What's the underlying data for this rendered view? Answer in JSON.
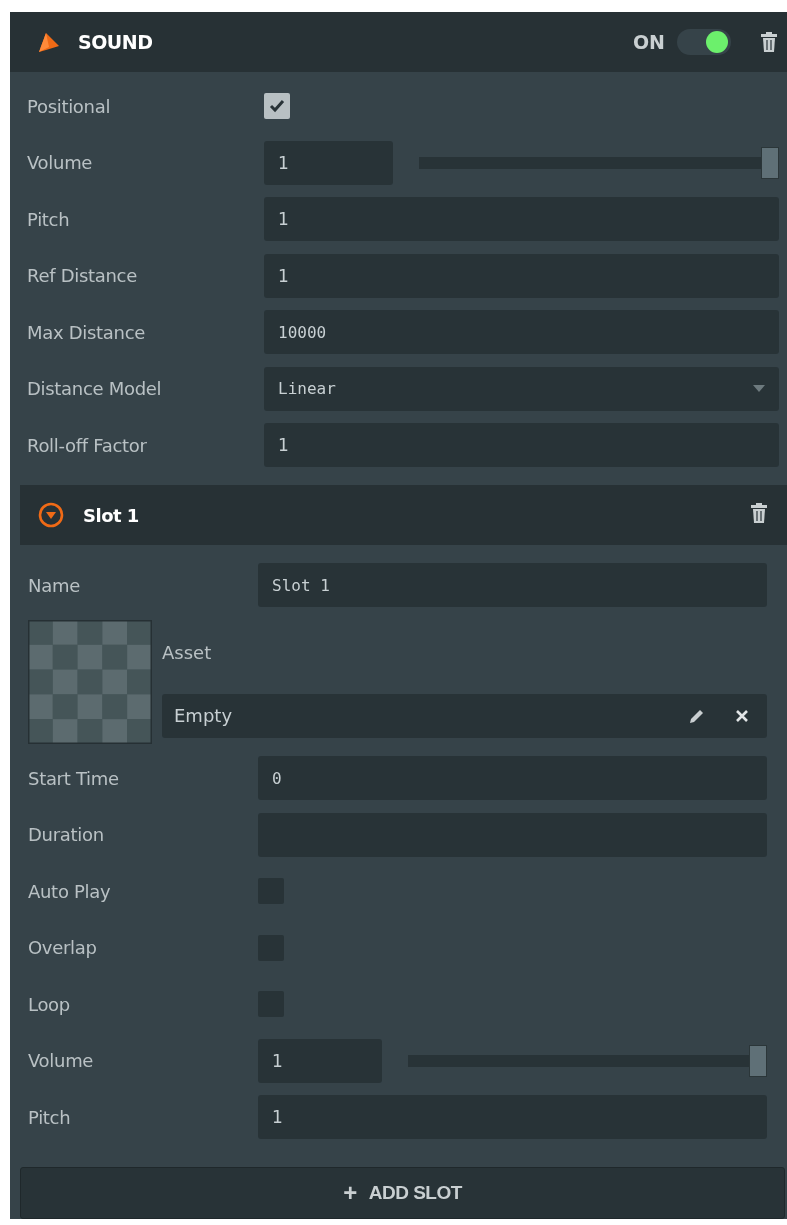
{
  "component": {
    "title": "SOUND",
    "enabled_label": "ON",
    "enabled": true
  },
  "properties": [
    {
      "kind": "checkbox",
      "label": "Positional",
      "checked": true
    },
    {
      "kind": "slider",
      "label": "Volume",
      "value": "1",
      "level": 1
    },
    {
      "kind": "field",
      "label": "Pitch",
      "value": "1"
    },
    {
      "kind": "field",
      "label": "Ref Distance",
      "value": "1"
    },
    {
      "kind": "field",
      "label": "Max Distance",
      "value": "10000",
      "mono": true
    },
    {
      "kind": "select",
      "label": "Distance Model",
      "value": "Linear"
    },
    {
      "kind": "field",
      "label": "Roll-off Factor",
      "value": "1"
    }
  ],
  "slots": [
    {
      "title": "Slot 1",
      "expanded": true,
      "properties": [
        {
          "kind": "field",
          "label": "Name",
          "value": "Slot 1",
          "mono": true
        },
        {
          "kind": "asset",
          "label": "Asset",
          "value": "Empty"
        },
        {
          "kind": "field",
          "label": "Start Time",
          "value": "0",
          "mono": true
        },
        {
          "kind": "field",
          "label": "Duration"
        },
        {
          "kind": "checkbox",
          "label": "Auto Play",
          "checked": false
        },
        {
          "kind": "checkbox",
          "label": "Overlap",
          "checked": false
        },
        {
          "kind": "checkbox",
          "label": "Loop",
          "checked": false
        },
        {
          "kind": "slider",
          "label": "Volume",
          "value": "1",
          "level": 1
        },
        {
          "kind": "field",
          "label": "Pitch",
          "value": "1"
        }
      ]
    }
  ],
  "add_button": {
    "icon": "+",
    "label": "ADD SLOT"
  }
}
